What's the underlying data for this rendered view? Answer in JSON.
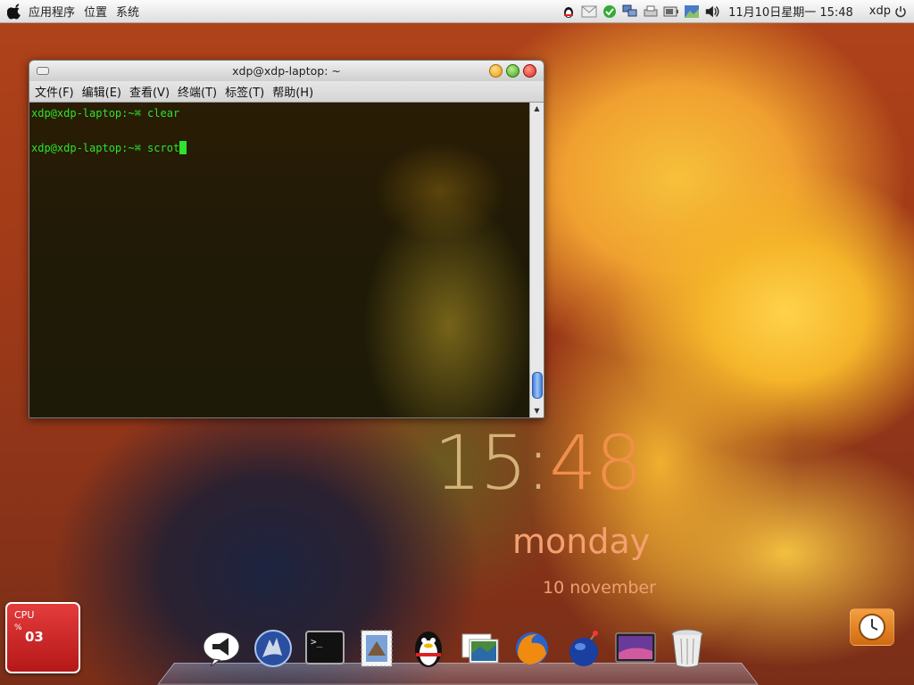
{
  "top_panel": {
    "menus": [
      "应用程序",
      "位置",
      "系统"
    ],
    "datetime": "11月10日星期一 15:48",
    "user": "xdp"
  },
  "terminal": {
    "title": "xdp@xdp-laptop: ~",
    "menus": [
      "文件(F)",
      "编辑(E)",
      "查看(V)",
      "终端(T)",
      "标签(T)",
      "帮助(H)"
    ],
    "lines": [
      {
        "prompt": "xdp@xdp-laptop:~⌘",
        "command": " clear"
      },
      {
        "prompt": "xdp@xdp-laptop:~⌘",
        "command": " scrot"
      }
    ]
  },
  "desktop_clock": {
    "hour": "15",
    "colon": ":",
    "minute": "48",
    "weekday": "monday",
    "date": "10 november"
  },
  "cpu_widget": {
    "label": "CPU",
    "unit": "%",
    "value": "03"
  },
  "dock": {
    "icons": [
      "megaphone-icon",
      "wolf-icon",
      "terminal-icon",
      "mail-stamp-icon",
      "qq-penguin-icon",
      "photos-icon",
      "firefox-icon",
      "bomb-globe-icon",
      "desktop-icon",
      "trash-icon"
    ]
  },
  "colors": {
    "terminal_text": "#2ee32e",
    "cpu_red": "#d42a2a"
  }
}
